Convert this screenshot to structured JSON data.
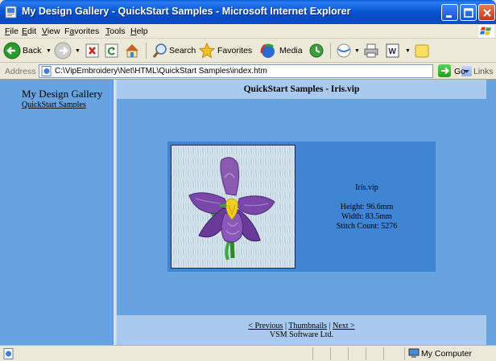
{
  "window": {
    "title": "My Design Gallery - QuickStart Samples - Microsoft Internet Explorer"
  },
  "menu": [
    {
      "label": "File",
      "mnemonic": "F"
    },
    {
      "label": "Edit",
      "mnemonic": "E"
    },
    {
      "label": "View",
      "mnemonic": "V"
    },
    {
      "label": "Favorites",
      "mnemonic": "a"
    },
    {
      "label": "Tools",
      "mnemonic": "T"
    },
    {
      "label": "Help",
      "mnemonic": "H"
    }
  ],
  "toolbar": {
    "back_label": "Back",
    "search_label": "Search",
    "favorites_label": "Favorites",
    "media_label": "Media"
  },
  "address": {
    "label": "Address",
    "value": "C:\\VipEmbroidery\\Net\\HTML\\QuickStart Samples\\index.htm",
    "go_label": "Go",
    "links_label": "Links",
    "links_chevron": "»"
  },
  "sidebar": {
    "site_title": "My Design Gallery",
    "link_label": "QuickStart Samples"
  },
  "page": {
    "title": "QuickStart Samples - Iris.vip",
    "design": {
      "name": "Iris.vip",
      "height": "Height: 96.6mm",
      "width": "Width: 83.5mm",
      "stitch_count": "Stitch Count: 5276"
    },
    "footer": {
      "previous": "< Previous",
      "thumbnails": "Thumbnails",
      "next": "Next >",
      "separator": "|",
      "copyright": "VSM Software Ltd."
    }
  },
  "status": {
    "zone": "My Computer"
  },
  "colors": {
    "titlebar": "#0a58d6",
    "content_bg": "#66a3e0",
    "header_bg": "#a9caee",
    "card_bg": "#3f85d4"
  }
}
